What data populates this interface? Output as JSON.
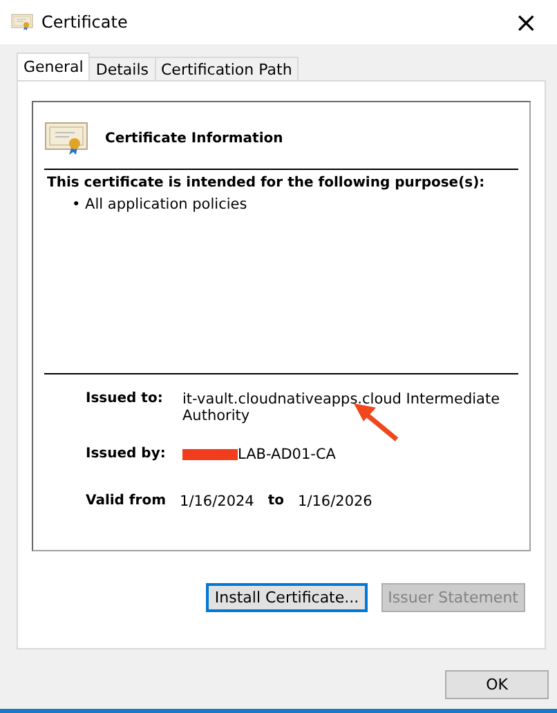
{
  "window": {
    "title": "Certificate",
    "close": "×"
  },
  "tabs": [
    {
      "label": "General",
      "selected": true
    },
    {
      "label": "Details",
      "selected": false
    },
    {
      "label": "Certification Path",
      "selected": false
    }
  ],
  "info": {
    "heading": "Certificate Information",
    "purpose_title": "This certificate is intended for the following purpose(s):",
    "purposes": [
      {
        "bullet": "•",
        "text": "All application policies"
      }
    ]
  },
  "fields": [
    {
      "label": "Issued to:",
      "value": "it-vault.cloudnativeapps.cloud Intermediate Authority",
      "redacted": false,
      "arrow": true
    },
    {
      "label": "Issued by:",
      "value": "LAB-AD01-CA",
      "redacted": true,
      "arrow": false
    }
  ],
  "validity": {
    "label": "Valid from",
    "from": "1/16/2024",
    "to_label": "to",
    "to": "1/16/2026"
  },
  "panel_buttons": [
    {
      "label": "Install Certificate...",
      "disabled": false,
      "focused": true
    },
    {
      "label": "Issuer Statement",
      "disabled": true,
      "focused": false
    }
  ],
  "ok_button": {
    "label": "OK"
  }
}
